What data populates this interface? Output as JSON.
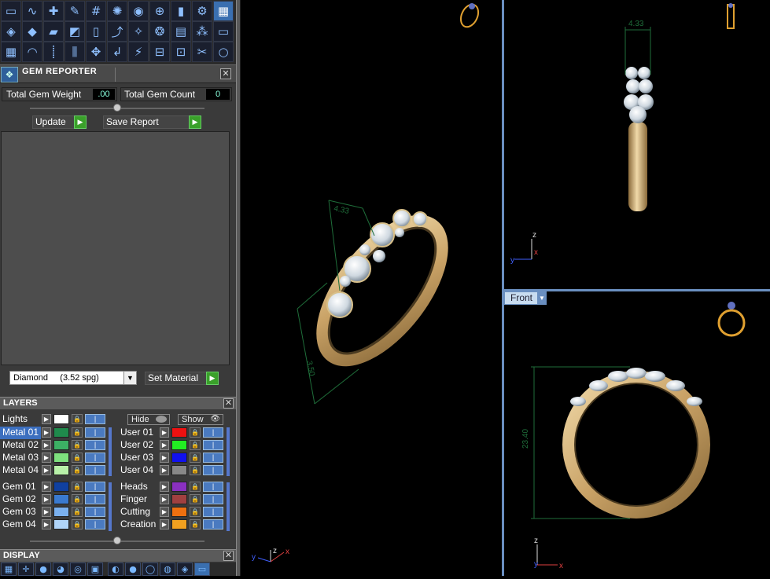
{
  "toolbar": {
    "rows": [
      [
        "layer-icon",
        "curve-icon",
        "add-curve-icon",
        "edit-curve-icon",
        "grid-curve-icon",
        "mesh-icon",
        "ball-icon",
        "gem-set-icon",
        "camera-icon",
        "settings-gear-icon",
        "window-icon"
      ],
      [
        "surface-icon",
        "diamond-icon",
        "sheet-icon",
        "plane-icon",
        "column-icon",
        "pave-icon",
        "sparkle-icon",
        "gem-ring-icon",
        "calculator-icon",
        "cluster-icon",
        "window-small-icon"
      ],
      [
        "cube-arrange-icon",
        "arc-icon",
        "dashed-curve-icon",
        "mirror-icon",
        "move-icon",
        "step-icon",
        "flare-icon",
        "link-icon",
        "split-icon",
        "cut-icon",
        "circle-icon"
      ]
    ],
    "glyphs": [
      [
        "▭",
        "∿",
        "✚",
        "✎",
        "#",
        "✺",
        "◉",
        "⊕",
        "▮",
        "⚙",
        "▦"
      ],
      [
        "◈",
        "◆",
        "▰",
        "◩",
        "▯",
        "⤴",
        "✧",
        "❂",
        "▤",
        "⁂",
        "▭"
      ],
      [
        "▦",
        "◠",
        "⸽",
        "⫼",
        "✥",
        "↲",
        "⚡",
        "⊟",
        "⊡",
        "✂",
        "○"
      ]
    ]
  },
  "gem_reporter": {
    "title": "GEM REPORTER",
    "total_weight_label": "Total Gem Weight",
    "total_weight_value": ".00",
    "total_count_label": "Total Gem Count",
    "total_count_value": "0",
    "update_label": "Update",
    "save_report_label": "Save Report",
    "material_value": "Diamond     (3.52 spg)",
    "set_material_label": "Set Material"
  },
  "layers": {
    "title": "LAYERS",
    "hide_label": "Hide",
    "show_label": "Show",
    "lights_label": "Lights",
    "left_group1": [
      {
        "name": "Metal 01",
        "color": "#1f8a4c",
        "selected": true
      },
      {
        "name": "Metal 02",
        "color": "#3cb064",
        "selected": false
      },
      {
        "name": "Metal 03",
        "color": "#7ee07e",
        "selected": false
      },
      {
        "name": "Metal 04",
        "color": "#b8f0a8",
        "selected": false
      }
    ],
    "right_group1": [
      {
        "name": "User 01",
        "color": "#ee1111"
      },
      {
        "name": "User 02",
        "color": "#22ee22"
      },
      {
        "name": "User 03",
        "color": "#1111ee"
      },
      {
        "name": "User 04",
        "color": "#888888"
      }
    ],
    "left_group2": [
      {
        "name": "Gem 01",
        "color": "#1040a0"
      },
      {
        "name": "Gem 02",
        "color": "#3a7ad0"
      },
      {
        "name": "Gem 03",
        "color": "#7ab0ee"
      },
      {
        "name": "Gem 04",
        "color": "#b0d4f8"
      }
    ],
    "right_group2": [
      {
        "name": "Heads",
        "color": "#8a30c0"
      },
      {
        "name": "Finger",
        "color": "#a04040"
      },
      {
        "name": "Cutting",
        "color": "#ee7010"
      },
      {
        "name": "Creation",
        "color": "#f0a020"
      }
    ]
  },
  "display": {
    "title": "DISPLAY"
  },
  "viewports": {
    "front_label": "Front",
    "persp_dimension": "4.33",
    "persp_dimension2": "3.50",
    "right_dimension": "4.33",
    "front_dimension": "23.40",
    "axis_x": "x",
    "axis_y": "y",
    "axis_z": "z"
  },
  "colors": {
    "gold": "#d4b07a",
    "dim_line": "#1f6e3a",
    "viewport_border": "#6a8fc0",
    "selection": "#3c6fbf"
  }
}
